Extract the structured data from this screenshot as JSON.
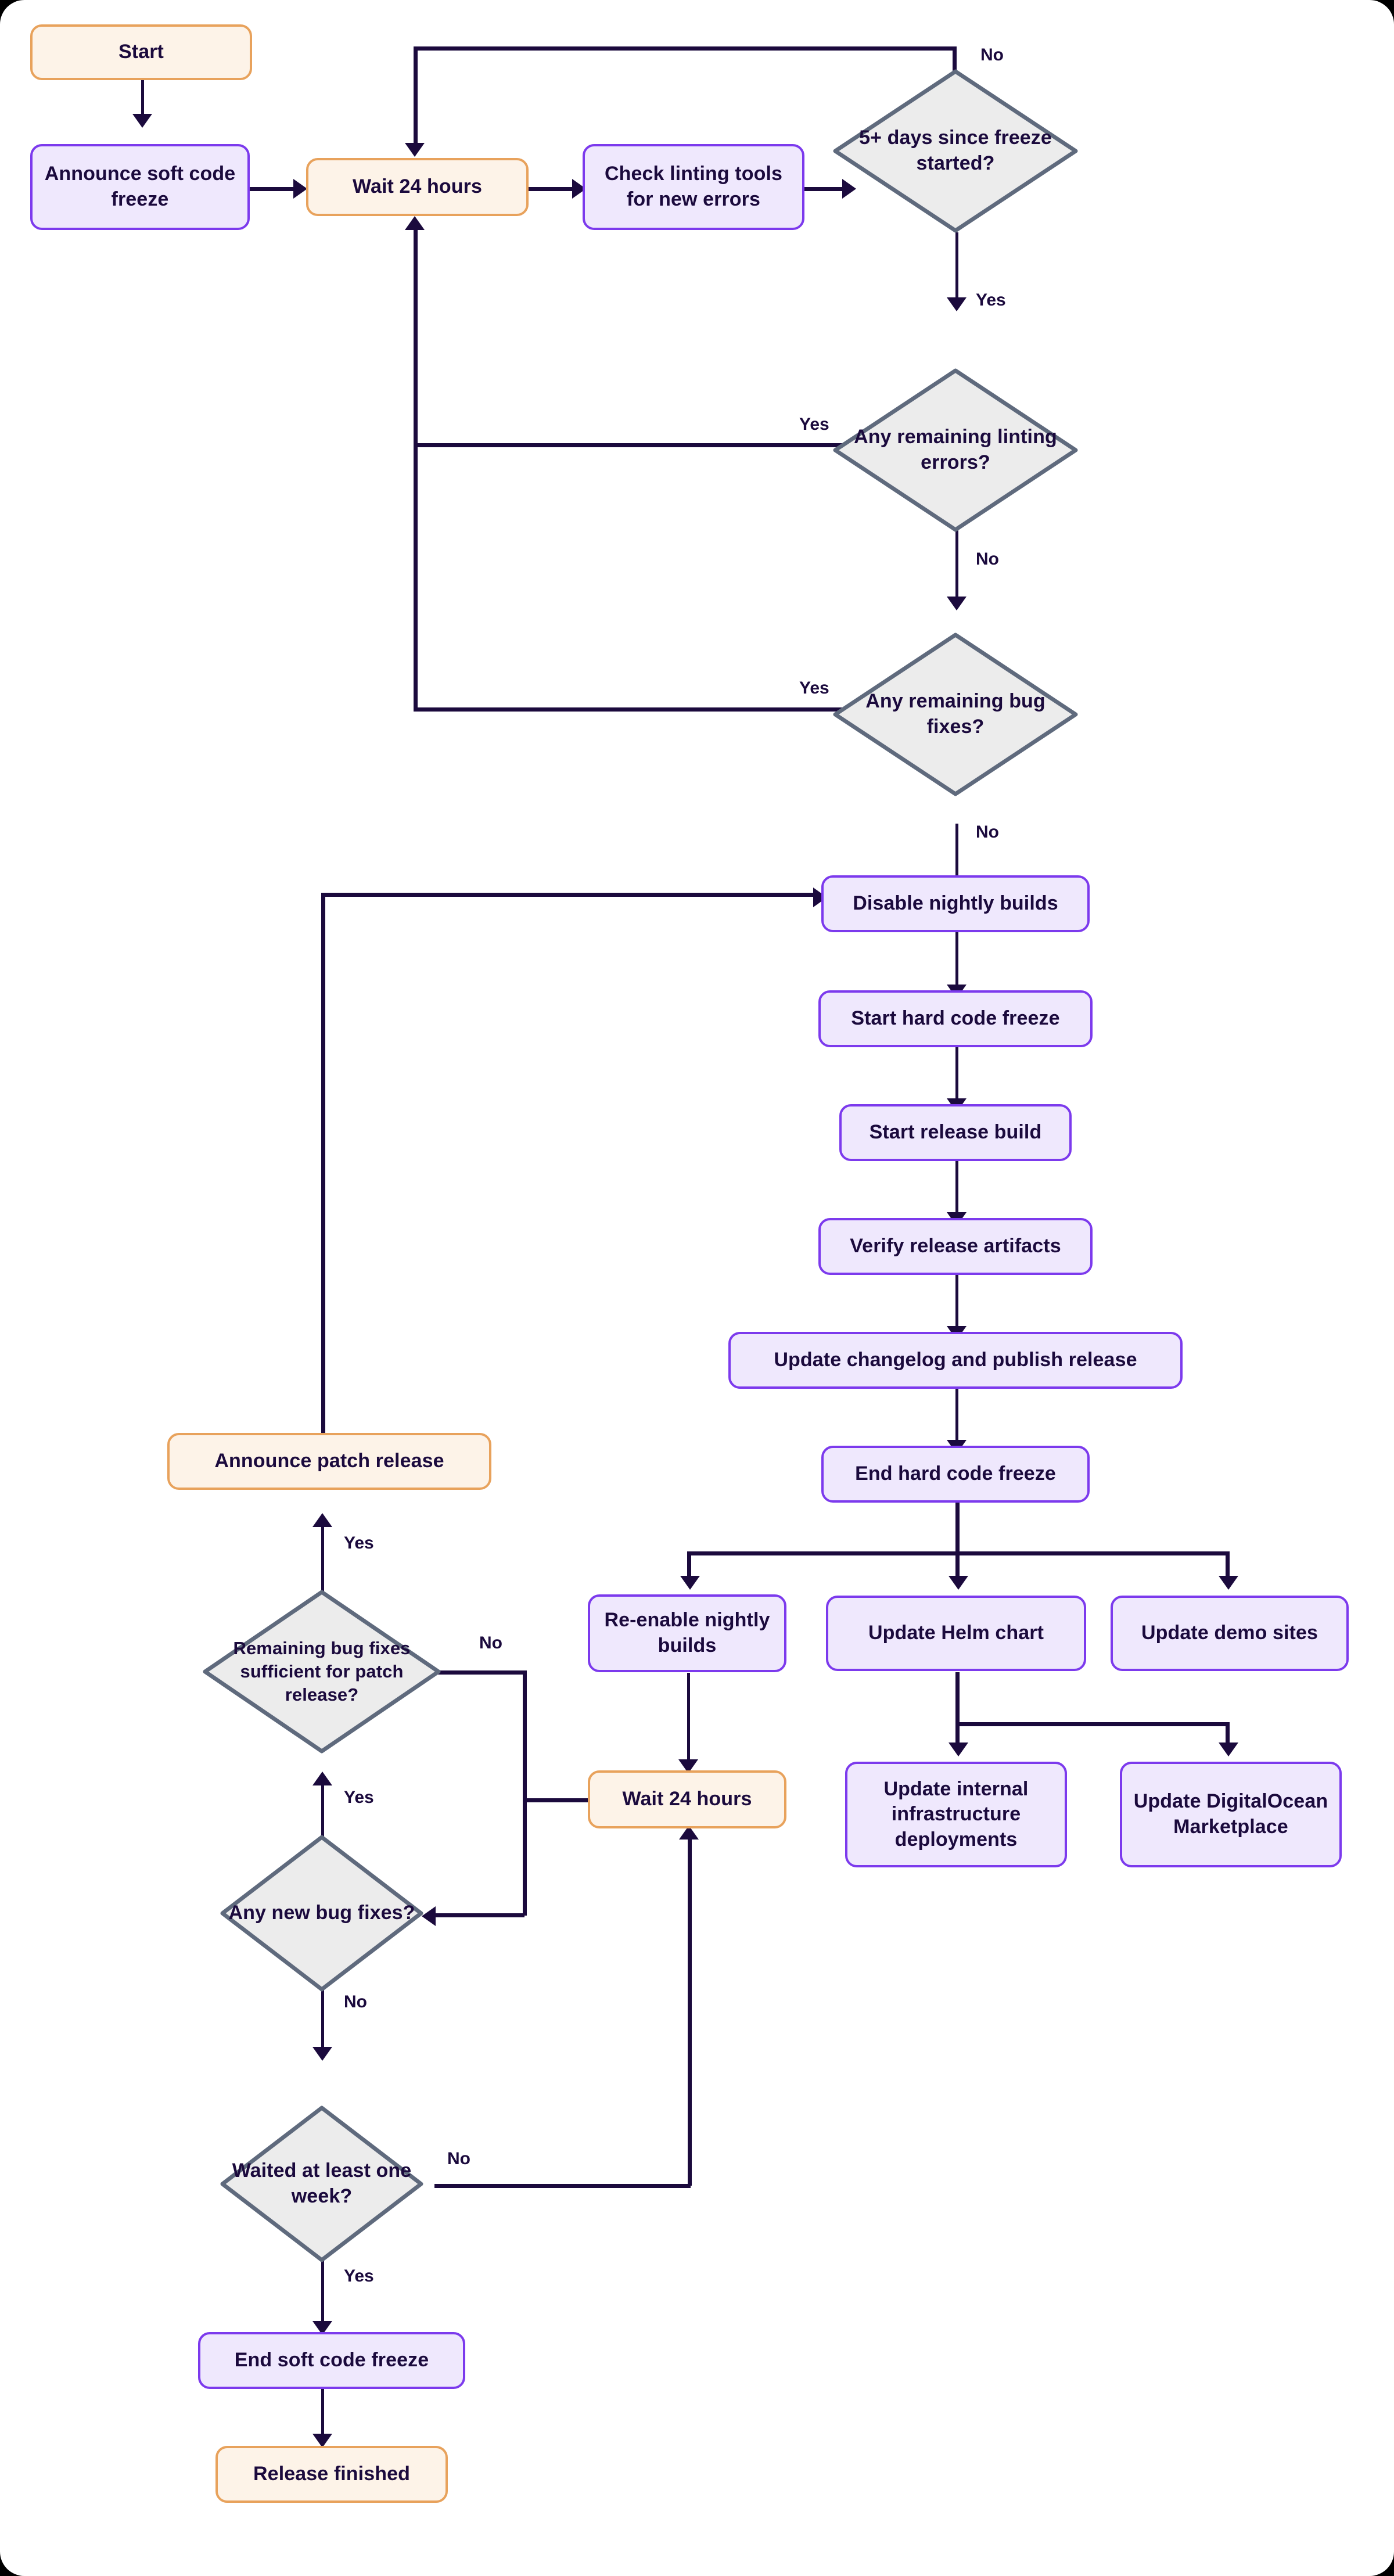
{
  "diagram": {
    "title": "Release process flowchart",
    "colors": {
      "process_fill": "#efe8fd",
      "process_border": "#7c3aed",
      "terminal_fill": "#fdf3e8",
      "terminal_border": "#e8a25c",
      "decision_fill": "#ececec",
      "decision_border": "#5f6a7d",
      "edge": "#1b0a3d",
      "text": "#1b0a3d",
      "background": "#ffffff"
    },
    "nodes": [
      {
        "id": "start",
        "type": "terminal",
        "label": "Start"
      },
      {
        "id": "announce_soft",
        "type": "process",
        "label": "Announce soft code freeze"
      },
      {
        "id": "wait24_top",
        "type": "terminal",
        "label": "Wait 24 hours"
      },
      {
        "id": "check_lint",
        "type": "process",
        "label": "Check linting tools for new errors"
      },
      {
        "id": "days5",
        "type": "decision",
        "label": "5+ days since freeze started?"
      },
      {
        "id": "lint_errors",
        "type": "decision",
        "label": "Any remaining linting errors?"
      },
      {
        "id": "bug_fixes",
        "type": "decision",
        "label": "Any remaining bug fixes?"
      },
      {
        "id": "disable_nightly",
        "type": "process",
        "label": "Disable nightly builds"
      },
      {
        "id": "start_hard",
        "type": "process",
        "label": "Start hard code freeze"
      },
      {
        "id": "start_build",
        "type": "process",
        "label": "Start release build"
      },
      {
        "id": "verify_artifacts",
        "type": "process",
        "label": "Verify release artifacts"
      },
      {
        "id": "update_changelog",
        "type": "process",
        "label": "Update changelog and publish release"
      },
      {
        "id": "end_hard",
        "type": "process",
        "label": "End hard code freeze"
      },
      {
        "id": "reenable",
        "type": "process",
        "label": "Re-enable nightly builds"
      },
      {
        "id": "helm",
        "type": "process",
        "label": "Update Helm chart"
      },
      {
        "id": "demo_sites",
        "type": "process",
        "label": "Update demo sites"
      },
      {
        "id": "internal_infra",
        "type": "process",
        "label": "Update internal infrastructure deployments"
      },
      {
        "id": "digitalocean",
        "type": "process",
        "label": "Update DigitalOcean Marketplace"
      },
      {
        "id": "announce_patch",
        "type": "terminal",
        "label": "Announce patch release"
      },
      {
        "id": "patch_sufficient",
        "type": "decision",
        "label": "Remaining bug fixes sufficient for patch release?"
      },
      {
        "id": "new_bug_fixes",
        "type": "decision",
        "label": "Any new bug fixes?"
      },
      {
        "id": "wait24_bottom",
        "type": "terminal",
        "label": "Wait 24 hours"
      },
      {
        "id": "waited_week",
        "type": "decision",
        "label": "Waited at least one week?"
      },
      {
        "id": "end_soft",
        "type": "process",
        "label": "End soft code freeze"
      },
      {
        "id": "release_finished",
        "type": "terminal",
        "label": "Release finished"
      }
    ],
    "edge_labels": {
      "days5_no": "No",
      "days5_yes": "Yes",
      "lint_yes": "Yes",
      "lint_no": "No",
      "bug_yes": "Yes",
      "bug_no": "No",
      "patch_yes": "Yes",
      "patch_no": "No",
      "newbug_yes": "Yes",
      "newbug_no": "No",
      "week_no": "No",
      "week_yes": "Yes"
    },
    "edges": [
      {
        "from": "start",
        "to": "announce_soft"
      },
      {
        "from": "announce_soft",
        "to": "wait24_top"
      },
      {
        "from": "wait24_top",
        "to": "check_lint"
      },
      {
        "from": "check_lint",
        "to": "days5"
      },
      {
        "from": "days5",
        "to": "wait24_top",
        "label": "No"
      },
      {
        "from": "days5",
        "to": "lint_errors",
        "label": "Yes"
      },
      {
        "from": "lint_errors",
        "to": "wait24_top",
        "label": "Yes"
      },
      {
        "from": "lint_errors",
        "to": "bug_fixes",
        "label": "No"
      },
      {
        "from": "bug_fixes",
        "to": "wait24_top",
        "label": "Yes"
      },
      {
        "from": "bug_fixes",
        "to": "disable_nightly",
        "label": "No"
      },
      {
        "from": "disable_nightly",
        "to": "start_hard"
      },
      {
        "from": "start_hard",
        "to": "start_build"
      },
      {
        "from": "start_build",
        "to": "verify_artifacts"
      },
      {
        "from": "verify_artifacts",
        "to": "update_changelog"
      },
      {
        "from": "update_changelog",
        "to": "end_hard"
      },
      {
        "from": "end_hard",
        "to": "reenable"
      },
      {
        "from": "end_hard",
        "to": "helm"
      },
      {
        "from": "end_hard",
        "to": "demo_sites"
      },
      {
        "from": "helm",
        "to": "internal_infra"
      },
      {
        "from": "helm",
        "to": "digitalocean"
      },
      {
        "from": "reenable",
        "to": "wait24_bottom"
      },
      {
        "from": "wait24_bottom",
        "to": "new_bug_fixes"
      },
      {
        "from": "new_bug_fixes",
        "to": "patch_sufficient",
        "label": "Yes"
      },
      {
        "from": "new_bug_fixes",
        "to": "waited_week",
        "label": "No"
      },
      {
        "from": "patch_sufficient",
        "to": "announce_patch",
        "label": "Yes"
      },
      {
        "from": "patch_sufficient",
        "to": "wait24_bottom",
        "label": "No"
      },
      {
        "from": "announce_patch",
        "to": "disable_nightly"
      },
      {
        "from": "waited_week",
        "to": "wait24_bottom",
        "label": "No"
      },
      {
        "from": "waited_week",
        "to": "end_soft",
        "label": "Yes"
      },
      {
        "from": "end_soft",
        "to": "release_finished"
      }
    ]
  }
}
